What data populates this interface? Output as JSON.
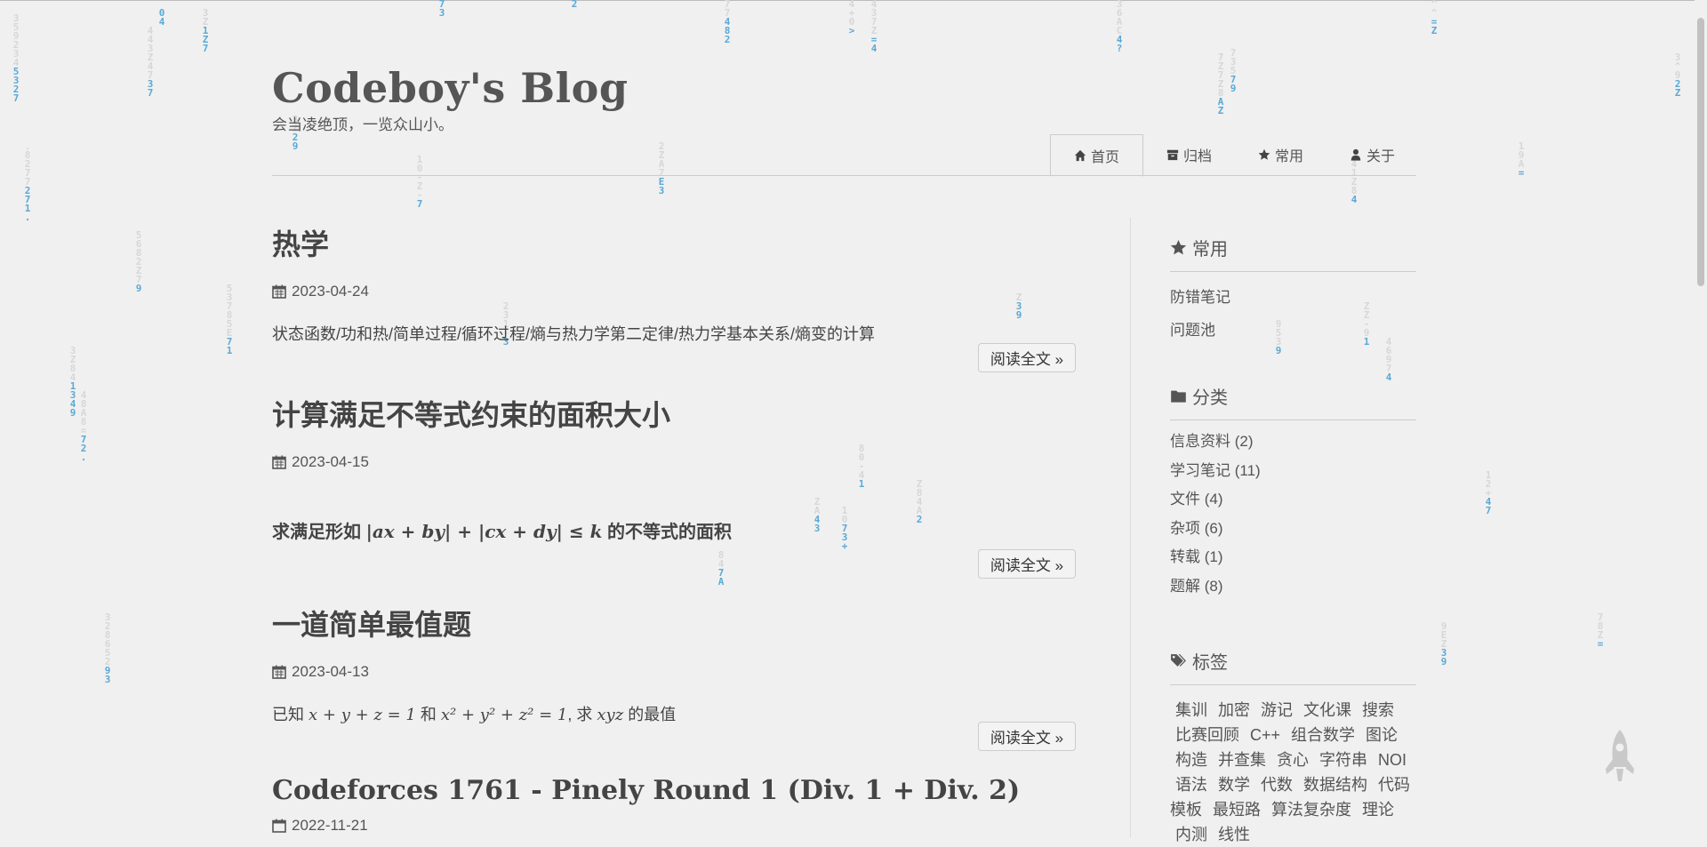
{
  "site": {
    "title": "Codeboy's Blog",
    "subtitle": "会当凌绝顶，一览众山小。"
  },
  "nav": [
    {
      "label": "首页",
      "icon": "home-icon",
      "active": true
    },
    {
      "label": "归档",
      "icon": "archive-icon"
    },
    {
      "label": "常用",
      "icon": "star-icon"
    },
    {
      "label": "关于",
      "icon": "user-icon"
    }
  ],
  "posts": [
    {
      "title": "热学",
      "date": "2023-04-24",
      "summary": "状态函数/功和热/简单过程/循环过程/熵与热力学第二定律/热力学基本关系/熵变的计算",
      "read_more": "阅读全文 »"
    },
    {
      "title": "计算满足不等式约束的面积大小",
      "date": "2023-04-15",
      "summary_prefix": "求满足形如",
      "summary_math": "|ax + by| + |cx + dy| ≤ k",
      "summary_suffix": "的不等式的面积",
      "read_more": "阅读全文 »"
    },
    {
      "title": "一道简单最值题",
      "date": "2023-04-13",
      "summary_a": "已知",
      "math_a": "x + y + z = 1",
      "summary_b": "和",
      "math_b": "x² + y² + z² = 1",
      "summary_c": ", 求",
      "math_c": "xyz",
      "summary_d": "的最值",
      "read_more": "阅读全文 »"
    },
    {
      "title": "Codeforces 1761 - Pinely Round 1 (Div. 1 + Div. 2)",
      "date": "2022-11-21"
    }
  ],
  "sidebar": {
    "common": {
      "title": "常用",
      "items": [
        "防错笔记",
        "问题池"
      ]
    },
    "categories": {
      "title": "分类",
      "items": [
        "信息资料 (2)",
        "学习笔记 (11)",
        "文件 (4)",
        "杂项 (6)",
        "转载 (1)",
        "题解 (8)"
      ]
    },
    "tags": {
      "title": "标签",
      "items": [
        "集训",
        "加密",
        "游记",
        "文化课",
        "搜索",
        "比赛回顾",
        "C++",
        "组合数学",
        "图论",
        "构造",
        "并查集",
        "贪心",
        "字符串",
        "NOI",
        "语法",
        "数学",
        "代数",
        "数据结构",
        "代码模板",
        "最短路",
        "算法复杂度",
        "理论",
        "内测",
        "线性"
      ]
    }
  },
  "colors": {
    "background": "#f0f0f0",
    "rain_highlight": "#5aa9d6",
    "text": "#444444"
  },
  "icons": {
    "date": "calendar-icon",
    "rocket": "rocket-icon",
    "folder": "folder-icon",
    "tags": "tags-icon"
  }
}
